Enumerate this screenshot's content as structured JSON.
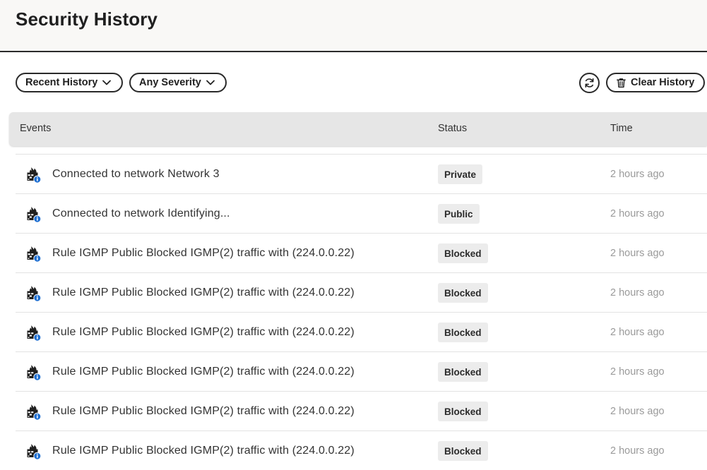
{
  "header": {
    "title": "Security History"
  },
  "toolbar": {
    "history_filter": {
      "label": "Recent History",
      "icon": "chevron-down-icon"
    },
    "severity_filter": {
      "label": "Any Severity",
      "icon": "chevron-down-icon"
    },
    "refresh": {
      "icon": "refresh-icon"
    },
    "clear": {
      "label": "Clear History",
      "icon": "trash-icon"
    }
  },
  "table": {
    "columns": [
      "Events",
      "Status",
      "Time"
    ],
    "rows": [
      {
        "icon": "firewall-info-icon",
        "event": "Connected to network Network 3",
        "status": "Private",
        "time": "2 hours ago"
      },
      {
        "icon": "firewall-info-icon",
        "event": "Connected to network Identifying...",
        "status": "Public",
        "time": "2 hours ago"
      },
      {
        "icon": "firewall-info-icon",
        "event": "Rule IGMP Public Blocked IGMP(2) traffic with (224.0.0.22)",
        "status": "Blocked",
        "time": "2 hours ago"
      },
      {
        "icon": "firewall-info-icon",
        "event": "Rule IGMP Public Blocked IGMP(2) traffic with (224.0.0.22)",
        "status": "Blocked",
        "time": "2 hours ago"
      },
      {
        "icon": "firewall-info-icon",
        "event": "Rule IGMP Public Blocked IGMP(2) traffic with (224.0.0.22)",
        "status": "Blocked",
        "time": "2 hours ago"
      },
      {
        "icon": "firewall-info-icon",
        "event": "Rule IGMP Public Blocked IGMP(2) traffic with (224.0.0.22)",
        "status": "Blocked",
        "time": "2 hours ago"
      },
      {
        "icon": "firewall-info-icon",
        "event": "Rule IGMP Public Blocked IGMP(2) traffic with (224.0.0.22)",
        "status": "Blocked",
        "time": "2 hours ago"
      },
      {
        "icon": "firewall-info-icon",
        "event": "Rule IGMP Public Blocked IGMP(2) traffic with (224.0.0.22)",
        "status": "Blocked",
        "time": "2 hours ago"
      }
    ]
  },
  "colors": {
    "header_bg": "#f9f8f6",
    "info_badge": "#1f6fd1",
    "table_header_bg": "#e6e6e6",
    "status_badge_bg": "#ececec",
    "time_text": "#9a9a9a"
  }
}
